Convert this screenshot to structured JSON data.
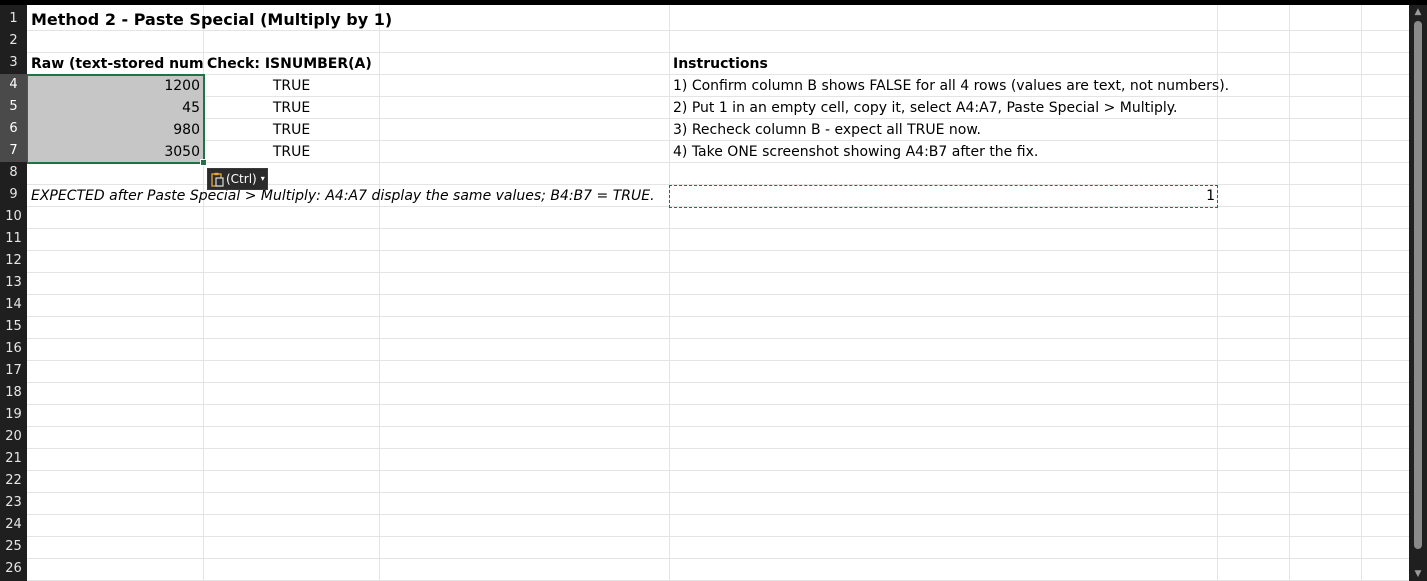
{
  "row_numbers": [
    "1",
    "2",
    "3",
    "4",
    "5",
    "6",
    "7",
    "8",
    "9",
    "10",
    "11",
    "12",
    "13",
    "14",
    "15",
    "16",
    "17",
    "18",
    "19",
    "20",
    "21",
    "22",
    "23",
    "24",
    "25",
    "26"
  ],
  "sheet": {
    "title": "Method 2 - Paste Special (Multiply by 1)",
    "header_a": "Raw (text-stored numbe",
    "header_b": "Check: ISNUMBER(A)",
    "header_instructions": "Instructions",
    "values": [
      "1200",
      "45",
      "980",
      "3050"
    ],
    "checks": [
      "TRUE",
      "TRUE",
      "TRUE",
      "TRUE"
    ],
    "instructions": [
      "1) Confirm column B shows FALSE for all 4 rows (values are text, not numbers).",
      "2) Put 1 in an empty cell, copy it, select A4:A7, Paste Special > Multiply.",
      "3) Recheck column B - expect all TRUE now.",
      "4) Take ONE screenshot showing A4:B7 after the fix."
    ],
    "expected_note": "EXPECTED after Paste Special > Multiply: A4:A7 display the same values; B4:B7 = TRUE.",
    "copied_value": "1"
  },
  "paste_options": {
    "label": "(Ctrl)",
    "icon": "clipboard-icon"
  },
  "colors": {
    "selection_border": "#217346",
    "selection_fill": "#c6c6c6",
    "row_header_bg": "#1f1f1f"
  }
}
